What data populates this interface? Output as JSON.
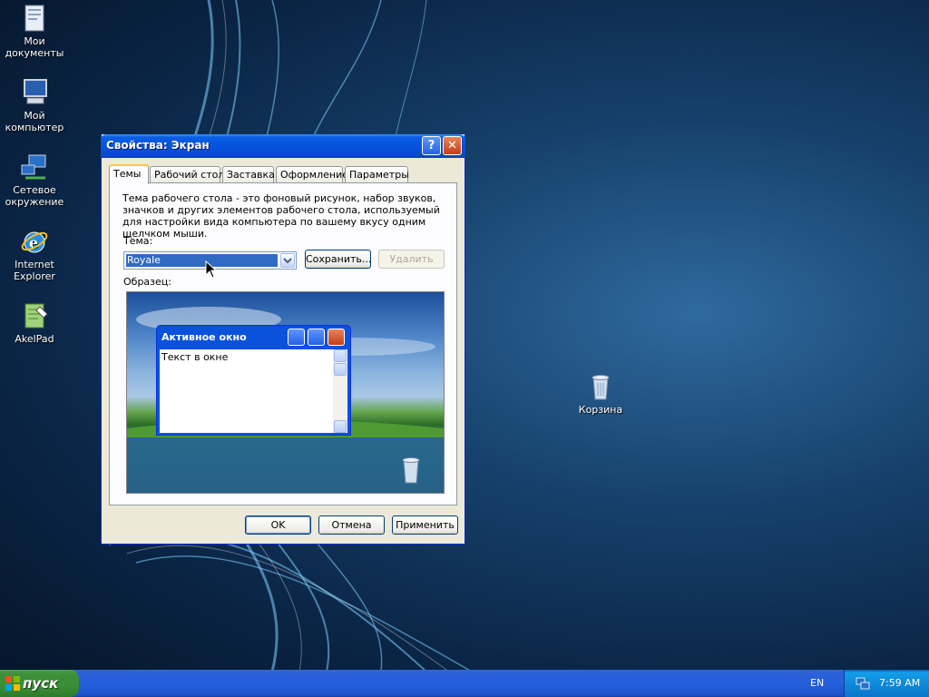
{
  "desktop": {
    "icons": [
      {
        "label_1": "Мои",
        "label_2": "документы",
        "icon": "my-documents-icon"
      },
      {
        "label_1": "Мой",
        "label_2": "компьютер",
        "icon": "my-computer-icon"
      },
      {
        "label_1": "Сетевое",
        "label_2": "окружение",
        "icon": "network-icon"
      },
      {
        "label_1": "Internet",
        "label_2": "Explorer",
        "icon": "internet-explorer-icon"
      },
      {
        "label_1": "AkelPad",
        "icon": "notepad-icon"
      },
      {
        "label_1": "Корзина",
        "icon": "recycle-bin-icon"
      }
    ]
  },
  "dialog": {
    "title": "Свойства: Экран",
    "tabs": [
      "Темы",
      "Рабочий стол",
      "Заставка",
      "Оформление",
      "Параметры"
    ],
    "active_tab": "Темы",
    "description": "Тема рабочего стола - это фоновый рисунок, набор звуков, значков и других элементов рабочего стола, используемый для настройки вида компьютера по вашему вкусу одним щелчком мыши.",
    "theme_label": "Тема:",
    "theme_value": "Royale",
    "save_button": "Сохранить...",
    "delete_button": "Удалить",
    "sample_label": "Образец:",
    "preview": {
      "window_title": "Активное окно",
      "window_text": "Текст в окне"
    },
    "ok_button": "OK",
    "cancel_button": "Отмена",
    "apply_button": "Применить"
  },
  "taskbar": {
    "start_label": "пуск",
    "language": "EN",
    "clock": "7:59 AM"
  },
  "colors": {
    "title_bar": "#0553dd",
    "start_button": "#3c8e39",
    "taskbar": "#245edb",
    "dialog_bg": "#ece9d8"
  }
}
